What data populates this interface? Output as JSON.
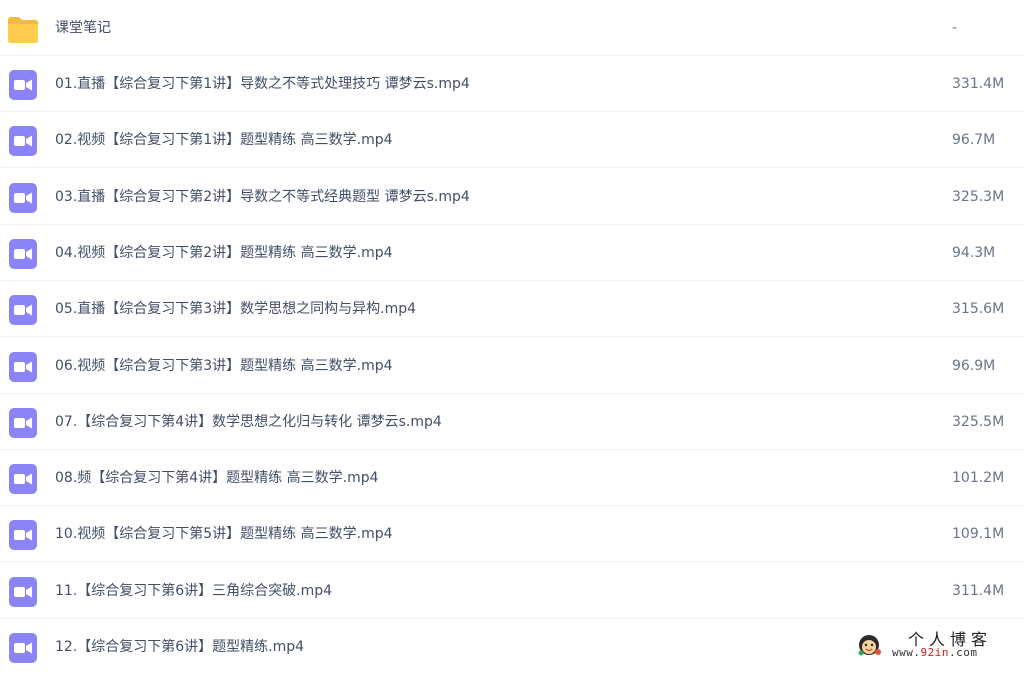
{
  "colors": {
    "folder": "#ffcc4d",
    "video_icon": "#8b84f7",
    "text": "#424e67",
    "divider": "#f1f2f4"
  },
  "files": [
    {
      "icon": "folder-icon",
      "name": "课堂笔记",
      "size": "-"
    },
    {
      "icon": "video-file-icon",
      "name": "01.直播【综合复习下第1讲】导数之不等式处理技巧 谭梦云s.mp4",
      "size": "331.4M"
    },
    {
      "icon": "video-file-icon",
      "name": "02.视频【综合复习下第1讲】题型精练 高三数学.mp4",
      "size": "96.7M"
    },
    {
      "icon": "video-file-icon",
      "name": "03.直播【综合复习下第2讲】导数之不等式经典题型 谭梦云s.mp4",
      "size": "325.3M"
    },
    {
      "icon": "video-file-icon",
      "name": "04.视频【综合复习下第2讲】题型精练 高三数学.mp4",
      "size": "94.3M"
    },
    {
      "icon": "video-file-icon",
      "name": "05.直播【综合复习下第3讲】数学思想之同构与异构.mp4",
      "size": "315.6M"
    },
    {
      "icon": "video-file-icon",
      "name": "06.视频【综合复习下第3讲】题型精练 高三数学.mp4",
      "size": "96.9M"
    },
    {
      "icon": "video-file-icon",
      "name": "07.【综合复习下第4讲】数学思想之化归与转化 谭梦云s.mp4",
      "size": "325.5M"
    },
    {
      "icon": "video-file-icon",
      "name": "08.频【综合复习下第4讲】题型精练 高三数学.mp4",
      "size": "101.2M"
    },
    {
      "icon": "video-file-icon",
      "name": "10.视频【综合复习下第5讲】题型精练 高三数学.mp4",
      "size": "109.1M"
    },
    {
      "icon": "video-file-icon",
      "name": "11.【综合复习下第6讲】三角综合突破.mp4",
      "size": "311.4M"
    },
    {
      "icon": "video-file-icon",
      "name": "12.【综合复习下第6讲】题型精练.mp4",
      "size": ""
    }
  ],
  "watermark": {
    "title": "个人博客",
    "url_prefix": "www.",
    "url_highlight": "92in",
    "url_suffix": ".com"
  }
}
